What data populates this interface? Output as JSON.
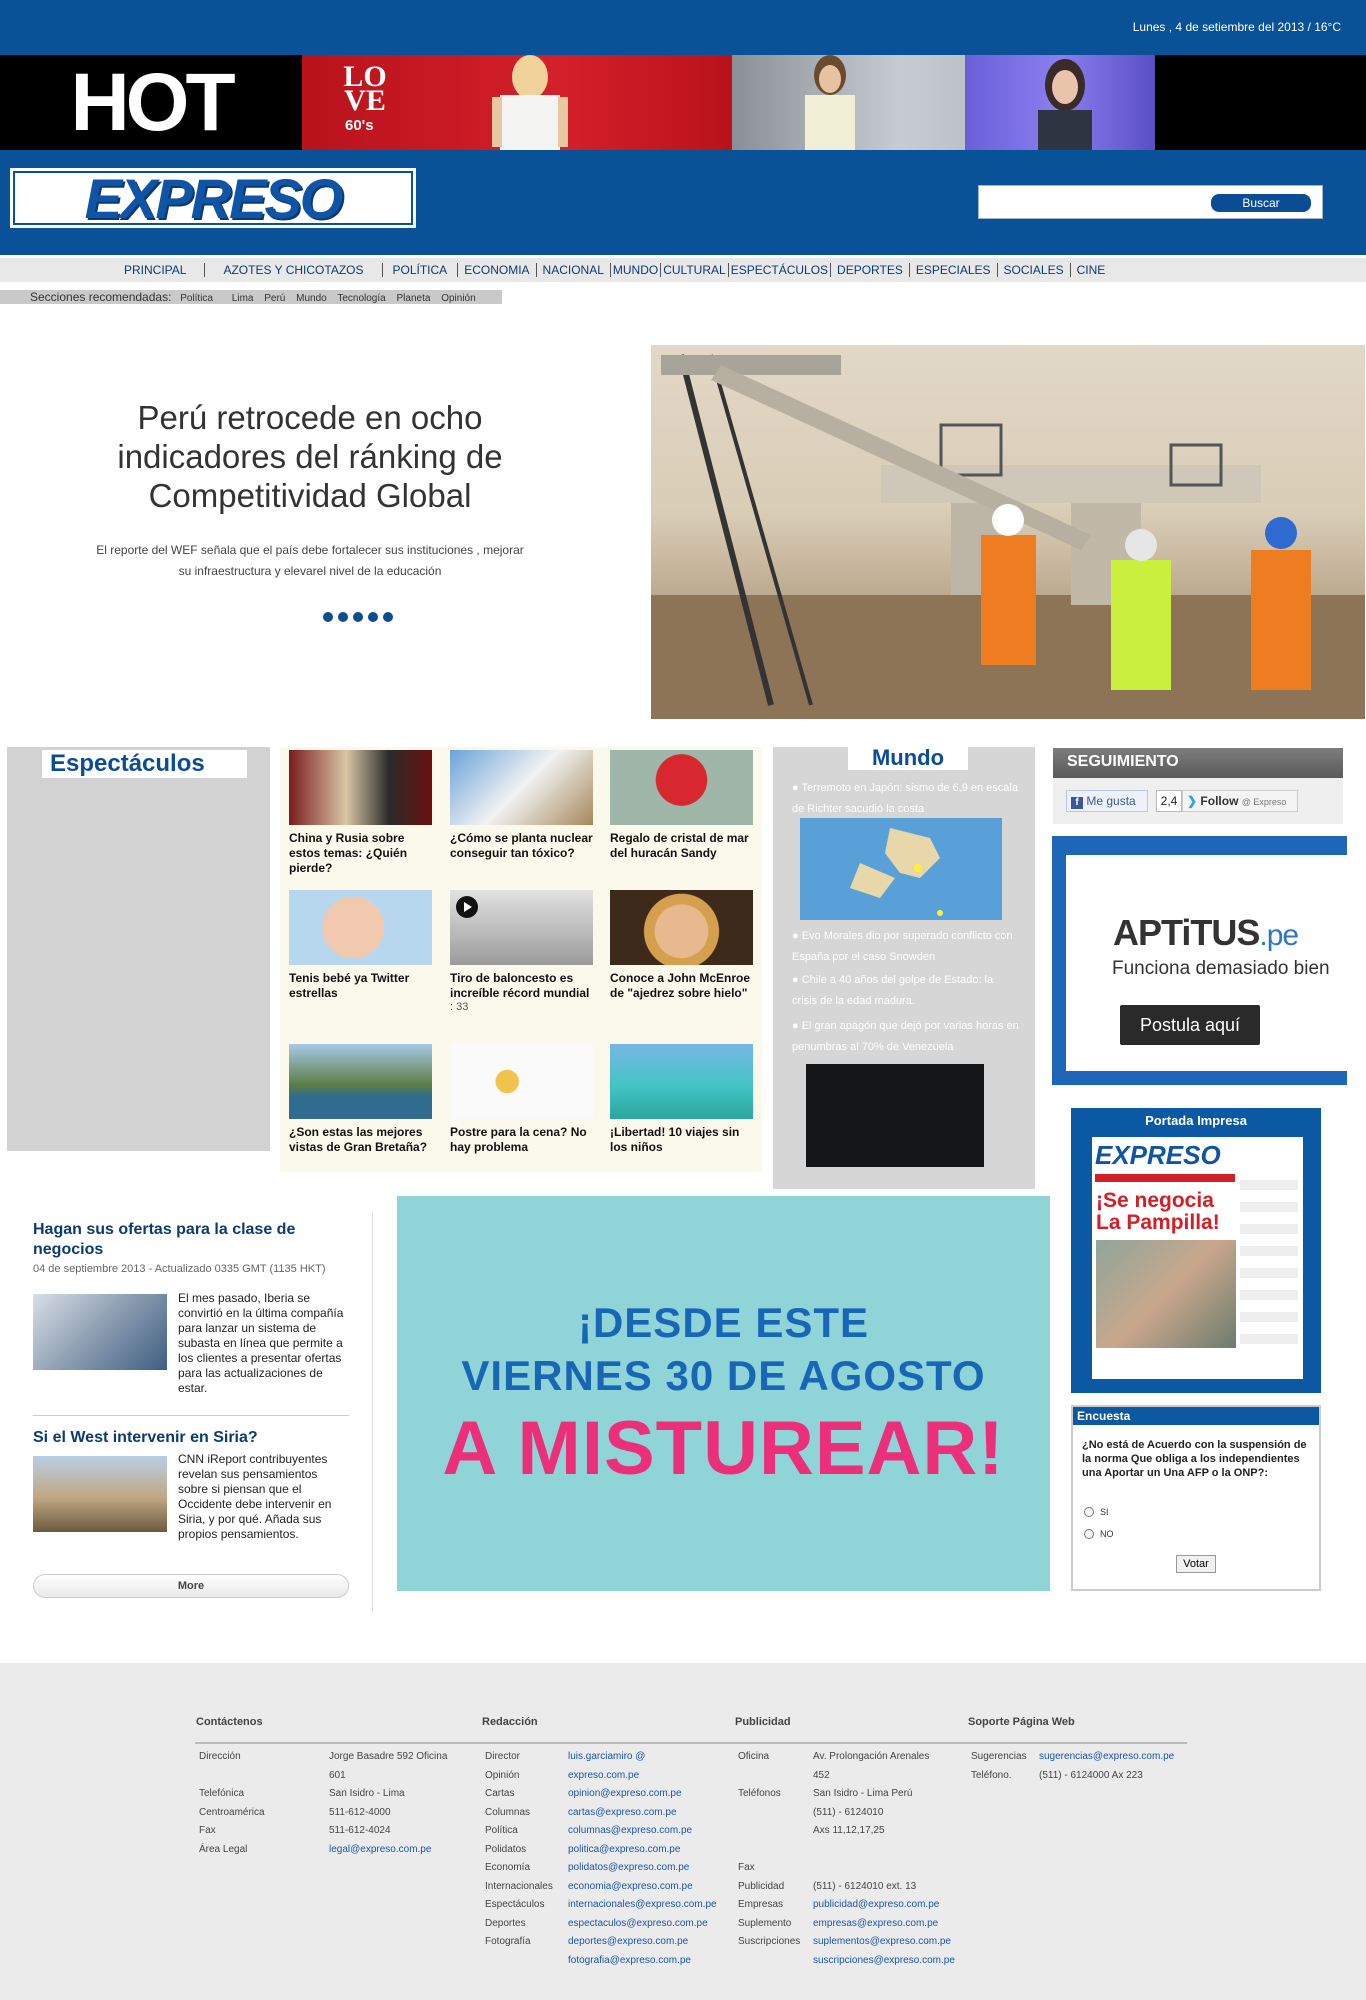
{
  "header": {
    "date": "Lunes , 4 de setiembre del 2013 / 16°C",
    "banner": {
      "brand": "HOT",
      "love_text": "LOVE",
      "love_sub": "60's"
    },
    "logo": "EXPRESO",
    "search": {
      "placeholder": "",
      "button": "Buscar"
    }
  },
  "nav": {
    "items": [
      "PRINCIPAL",
      "AZOTES Y CHICOTAZOS",
      "POLÍTICA",
      "ECONOMIA",
      "NACIONAL",
      "MUNDO",
      "CULTURAL",
      "ESPECTÁCULOS",
      "DEPORTES",
      "ESPECIALES",
      "SOCIALES",
      "CINE"
    ],
    "recommended_label": "Secciones recomendadas:",
    "recommended": [
      "Política",
      "Lima",
      "Perú",
      "Mundo",
      "Tecnología",
      "Planeta",
      "Opinión"
    ]
  },
  "hero": {
    "title": "Perú retrocede en ocho indicadores del ránking de Competitividad Global",
    "description": "El reporte del WEF señala que el país debe fortalecer sus instituciones , mejorar su infraestructura y elevarel nivel de la educación",
    "slide_count": 5
  },
  "espectaculos": {
    "title": "Espectáculos",
    "cards": [
      {
        "caption": "China y Rusia sobre estos temas: ¿Quién pierde?",
        "extra": ""
      },
      {
        "caption": "¿Cómo se planta nuclear conseguir tan tóxico?",
        "extra": ""
      },
      {
        "caption": "Regalo de cristal de mar del huracán Sandy",
        "extra": ""
      },
      {
        "caption": "Tenis bebé ya Twitter estrellas",
        "extra": ""
      },
      {
        "caption": "Tiro de baloncesto es increíble récord mundial",
        "extra": ": 33"
      },
      {
        "caption": "Conoce a John McEnroe de \"ajedrez sobre hielo\"",
        "extra": ""
      },
      {
        "caption": "¿Son estas las mejores vistas de Gran Bretaña?",
        "extra": ""
      },
      {
        "caption": "Postre para la cena? No hay problema",
        "extra": ""
      },
      {
        "caption": "¡Libertad! 10 viajes sin los niños",
        "extra": ""
      }
    ]
  },
  "mundo": {
    "title": "Mundo",
    "items": [
      "Terremoto en Japón: sismo de 6,9 en escala de Richter sacudió la costa",
      "Evo Morales dio por superado conflicto con España por el caso Snowden",
      "Chile a 40 años del golpe de Estado: la crisis de la edad madura.",
      "El gran apagón que dejó por varias horas en penumbras al 70% de Venezuela"
    ]
  },
  "seguimiento": {
    "title": "SEGUIMIENTO",
    "like": "Me gusta",
    "like_count": "2,4",
    "follow": "Follow",
    "follow_handle": "@ Expreso"
  },
  "aptitus": {
    "brand": "APTiTUS",
    "domain": ".pe",
    "tagline": "Funciona demasiado bien",
    "button": "Postula aquí"
  },
  "portada": {
    "title": "Portada Impresa",
    "paper_logo": "EXPRESO",
    "headline": "¡Se negocia La Pampilla!"
  },
  "encuesta": {
    "title": "Encuesta",
    "question": "¿No está de Acuerdo con la suspensión de la norma Que obliga a los independientes una Aportar un Una AFP o la ONP?:",
    "options": [
      "SI",
      "NO"
    ],
    "vote": "Votar"
  },
  "cnn": {
    "stories": [
      {
        "title": "Hagan sus ofertas para la clase de negocios",
        "meta": "04 de septiembre 2013 - Actualizado 0335 GMT (1135 HKT)",
        "text": "El mes pasado, Iberia se convirtió en la última compañía para lanzar un sistema de subasta en línea que permite a los clientes a presentar ofertas para las actualizaciones de estar."
      },
      {
        "title": "Si el West intervenir en Siria?",
        "meta": "",
        "text": "CNN iReport contribuyentes revelan sus pensamientos sobre si piensan que el Occidente debe intervenir en Siria, y por qué. Añada sus propios pensamientos."
      }
    ],
    "more": "More"
  },
  "promo": {
    "line1": "¡DESDE ESTE",
    "line2": "VIERNES 30 DE AGOSTO",
    "line3": "A MISTUREAR!"
  },
  "footer": {
    "headings": [
      "Contáctenos",
      "Redacción",
      "Publicidad",
      "Soporte Página Web"
    ],
    "contact_labels": [
      "Dirección",
      "",
      "Telefónica",
      "Centroamérica",
      "Fax",
      "Área Legal"
    ],
    "contact_values": [
      "Jorge Basadre 592 Oficina",
      "601",
      "San Isidro - Lima",
      "511-612-4000",
      "511-612-4024",
      "legal@expreso.com.pe"
    ],
    "redaccion_labels": [
      "Director",
      "Opinión",
      "Cartas",
      "Columnas",
      "Política",
      "Polidatos",
      "Economía",
      "Internacionales",
      "Espectáculos",
      "Deportes",
      "Fotografía"
    ],
    "redaccion_values": [
      "luis.garciamiro @",
      "expreso.com.pe",
      "opinion@expreso.com.pe",
      "cartas@expreso.com.pe",
      "columnas@expreso.com.pe",
      "politica@expreso.com.pe",
      "polidatos@expreso.com.pe",
      "economia@expreso.com.pe",
      "internacionales@expreso.com.pe",
      "espectaculos@expreso.com.pe",
      "deportes@expreso.com.pe",
      "fotografia@expreso.com.pe"
    ],
    "publicidad_labels": [
      "Oficina",
      "",
      "Teléfonos",
      "",
      "",
      "",
      "Fax",
      "Publicidad",
      "Empresas",
      "Suplemento",
      "Suscripciones"
    ],
    "publicidad_values": [
      "Av. Prolongación Arenales",
      "452",
      "San Isidro - Lima Perú",
      "(511) - 6124010",
      "Axs 11,12,17,25",
      "",
      "",
      "(511) - 6124010 ext. 13",
      "publicidad@expreso.com.pe",
      "empresas@expreso.com.pe",
      "suplementos@expreso.com.pe",
      "suscripciones@expreso.com.pe"
    ],
    "soporte_labels": [
      "Sugerencias",
      "Teléfono."
    ],
    "soporte_values": [
      "sugerencias@expreso.com.pe",
      "(511) - 6124000 Ax 223"
    ]
  },
  "colors": {
    "brand_blue": "#0a5298",
    "nav_bg": "#e8e8e8",
    "promo_bg": "#8fd4d6",
    "promo_pink": "#ec2f7a"
  }
}
